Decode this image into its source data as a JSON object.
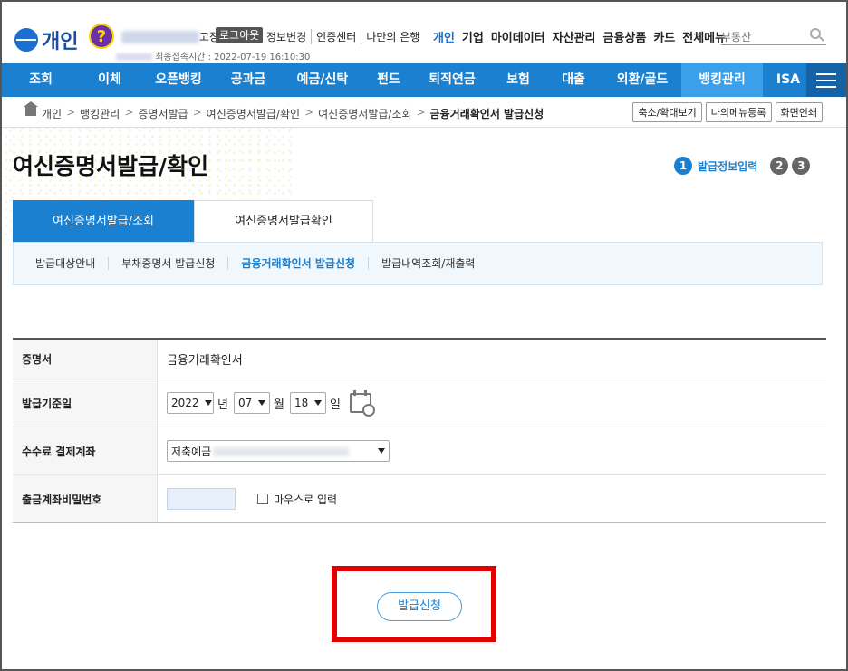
{
  "header": {
    "logo_text": "개인",
    "help_symbol": "?",
    "user_suffix": "고장",
    "logout_label": "로그아웃",
    "util_links": [
      "정보변경",
      "인증센터",
      "나만의 은행"
    ],
    "last_login_label": "최종접속시간 :",
    "last_login_time": "2022-07-19 16:10:30",
    "gnb_links": [
      "개인",
      "기업",
      "마이데이터",
      "자산관리",
      "금융상품",
      "카드",
      "전체메뉴"
    ],
    "gnb_active": "개인",
    "search_placeholder": "부동산"
  },
  "main_nav": {
    "items": [
      "조회",
      "이체",
      "오픈뱅킹",
      "공과금",
      "예금/신탁",
      "펀드",
      "퇴직연금",
      "보험",
      "대출",
      "외환/골드",
      "뱅킹관리",
      "ISA"
    ],
    "active": "뱅킹관리"
  },
  "breadcrumb": {
    "items": [
      "개인",
      "뱅킹관리",
      "증명서발급",
      "여신증명서발급/확인",
      "여신증명서발급/조회",
      "금융거래확인서 발급신청"
    ],
    "separator": ">"
  },
  "tools": [
    "축소/확대보기",
    "나의메뉴등록",
    "화면인쇄"
  ],
  "page": {
    "title": "여신증명서발급/확인",
    "steps": [
      {
        "number": "1",
        "label": "발급정보입력"
      },
      {
        "number": "2",
        "label": ""
      },
      {
        "number": "3",
        "label": ""
      }
    ]
  },
  "tabs": [
    "여신증명서발급/조회",
    "여신증명서발급확인"
  ],
  "active_tab": "여신증명서발급/조회",
  "subtabs": [
    "발급대상안내",
    "부채증명서 발급신청",
    "금융거래확인서 발급신청",
    "발급내역조회/재출력"
  ],
  "active_subtab": "금융거래확인서 발급신청",
  "form": {
    "certificate_label": "증명서",
    "certificate_value": "금융거래확인서",
    "base_date_label": "발급기준일",
    "year": "2022",
    "year_unit": "년",
    "month": "07",
    "month_unit": "월",
    "day": "18",
    "day_unit": "일",
    "fee_account_label": "수수료 결제계좌",
    "fee_account_value": "저축예금",
    "password_label": "출금계좌비밀번호",
    "mouse_input_label": "마우스로 입력"
  },
  "submit_label": "발급신청",
  "colors": {
    "nav_blue": "#1a80cf",
    "nav_active": "#3aa0ea",
    "highlight_red": "#e50000"
  }
}
